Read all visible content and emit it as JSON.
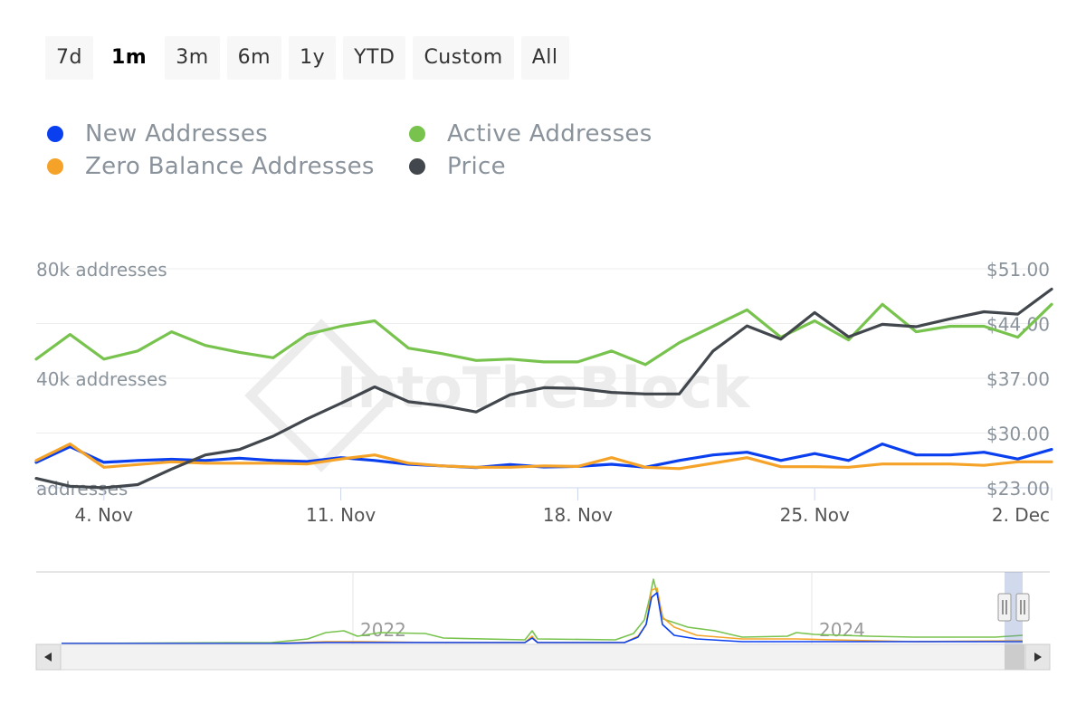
{
  "range_selector": {
    "buttons": [
      {
        "label": "7d",
        "active": false
      },
      {
        "label": "1m",
        "active": true
      },
      {
        "label": "3m",
        "active": false
      },
      {
        "label": "6m",
        "active": false
      },
      {
        "label": "1y",
        "active": false
      },
      {
        "label": "YTD",
        "active": false
      },
      {
        "label": "Custom",
        "active": false
      },
      {
        "label": "All",
        "active": false
      }
    ]
  },
  "watermark": "IntoTheBlock",
  "navigator": {
    "labels": [
      "2022",
      "2024"
    ]
  },
  "chart_data": {
    "type": "line",
    "x": [
      "2024-11-02",
      "2024-11-03",
      "2024-11-04",
      "2024-11-05",
      "2024-11-06",
      "2024-11-07",
      "2024-11-08",
      "2024-11-09",
      "2024-11-10",
      "2024-11-11",
      "2024-11-12",
      "2024-11-13",
      "2024-11-14",
      "2024-11-15",
      "2024-11-16",
      "2024-11-17",
      "2024-11-18",
      "2024-11-19",
      "2024-11-20",
      "2024-11-21",
      "2024-11-22",
      "2024-11-23",
      "2024-11-24",
      "2024-11-25",
      "2024-11-26",
      "2024-11-27",
      "2024-11-28",
      "2024-11-29",
      "2024-11-30",
      "2024-12-01",
      "2024-12-02"
    ],
    "x_ticks": [
      "4. Nov",
      "11. Nov",
      "18. Nov",
      "25. Nov",
      "2. Dec"
    ],
    "y_left": {
      "ticks": [
        "80k addresses",
        "40k addresses",
        "addresses"
      ],
      "range": [
        0,
        80000
      ]
    },
    "y_right": {
      "ticks": [
        "$51.00",
        "$44.00",
        "$37.00",
        "$30.00",
        "$23.00"
      ],
      "range": [
        23,
        51
      ]
    },
    "series": [
      {
        "name": "New Addresses",
        "color": "#0a3ff0",
        "axis": "left",
        "values": [
          9300,
          15000,
          9300,
          10000,
          10400,
          10000,
          10800,
          10000,
          9600,
          11000,
          10000,
          8600,
          8000,
          7400,
          8500,
          7600,
          7800,
          8600,
          7500,
          10000,
          12000,
          13000,
          10000,
          12500,
          10000,
          16000,
          12000,
          12000,
          13000,
          10500,
          14000
        ]
      },
      {
        "name": "Active Addresses",
        "color": "#78c34e",
        "axis": "left",
        "values": [
          47000,
          56000,
          47000,
          50000,
          57000,
          52000,
          49500,
          47500,
          56000,
          59000,
          61000,
          51000,
          49000,
          46500,
          47000,
          46000,
          46000,
          50000,
          45000,
          53000,
          59000,
          65000,
          55000,
          61000,
          54000,
          67000,
          57000,
          59000,
          59000,
          55000,
          67000
        ]
      },
      {
        "name": "Zero Balance Addresses",
        "color": "#f5a328",
        "axis": "left",
        "values": [
          10000,
          16000,
          7500,
          8500,
          9500,
          9000,
          9000,
          9000,
          8700,
          10500,
          12000,
          9000,
          8000,
          7500,
          7500,
          8000,
          7800,
          11000,
          7500,
          7000,
          9000,
          11000,
          7700,
          7700,
          7500,
          8700,
          8700,
          8700,
          8200,
          9500,
          9500
        ]
      },
      {
        "name": "Price",
        "color": "#41474c",
        "axis": "right",
        "values": [
          24.2,
          23.2,
          23.0,
          23.4,
          25.4,
          27.2,
          27.9,
          29.6,
          31.8,
          33.8,
          35.9,
          34.0,
          33.5,
          32.7,
          34.9,
          35.8,
          35.7,
          35.2,
          35.0,
          35.0,
          40.5,
          43.7,
          42.0,
          45.4,
          42.3,
          43.9,
          43.6,
          44.6,
          45.5,
          45.2,
          48.4
        ]
      }
    ]
  }
}
